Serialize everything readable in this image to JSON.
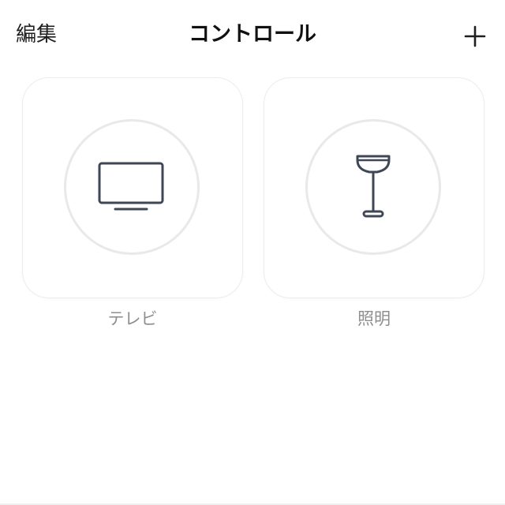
{
  "header": {
    "edit_label": "編集",
    "title": "コントロール",
    "add_icon": "plus-icon"
  },
  "devices": [
    {
      "label": "テレビ",
      "icon": "tv-icon"
    },
    {
      "label": "照明",
      "icon": "floor-lamp-icon"
    }
  ],
  "colors": {
    "background": "#ffffff",
    "title": "#111111",
    "label": "#8e8e8e",
    "icon_stroke": "#3f4654",
    "card_border": "#ececec",
    "circle_border": "#e9e9e9"
  }
}
